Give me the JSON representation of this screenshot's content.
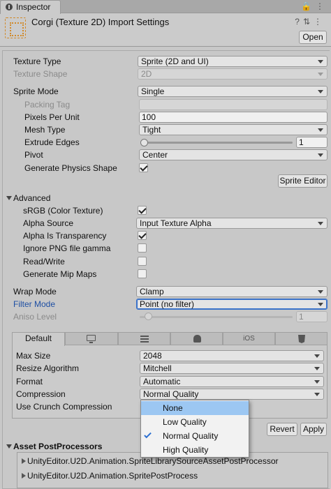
{
  "tab": {
    "title": "Inspector"
  },
  "header": {
    "title": "Corgi (Texture 2D) Import Settings",
    "open_label": "Open"
  },
  "fields": {
    "texture_type": {
      "label": "Texture Type",
      "value": "Sprite (2D and UI)"
    },
    "texture_shape": {
      "label": "Texture Shape",
      "value": "2D"
    },
    "sprite_mode": {
      "label": "Sprite Mode",
      "value": "Single"
    },
    "packing_tag": {
      "label": "Packing Tag",
      "value": ""
    },
    "pixels_per_unit": {
      "label": "Pixels Per Unit",
      "value": "100"
    },
    "mesh_type": {
      "label": "Mesh Type",
      "value": "Tight"
    },
    "extrude_edges": {
      "label": "Extrude Edges",
      "value": "1"
    },
    "pivot": {
      "label": "Pivot",
      "value": "Center"
    },
    "generate_physics_shape": {
      "label": "Generate Physics Shape",
      "checked": true
    },
    "sprite_editor_label": "Sprite Editor"
  },
  "advanced": {
    "label": "Advanced",
    "srgb": {
      "label": "sRGB (Color Texture)",
      "checked": true
    },
    "alpha_source": {
      "label": "Alpha Source",
      "value": "Input Texture Alpha"
    },
    "alpha_is_transparency": {
      "label": "Alpha Is Transparency",
      "checked": true
    },
    "ignore_png_gamma": {
      "label": "Ignore PNG file gamma",
      "checked": false
    },
    "read_write": {
      "label": "Read/Write",
      "checked": false
    },
    "generate_mip_maps": {
      "label": "Generate Mip Maps",
      "checked": false
    }
  },
  "wrap": {
    "wrap_mode": {
      "label": "Wrap Mode",
      "value": "Clamp"
    },
    "filter_mode": {
      "label": "Filter Mode",
      "value": "Point (no filter)"
    },
    "aniso_level": {
      "label": "Aniso Level",
      "value": "1"
    }
  },
  "platform": {
    "tabs": [
      {
        "label": "Default",
        "icon": "default"
      },
      {
        "label": "",
        "icon": "monitor-icon"
      },
      {
        "label": "",
        "icon": "grid-icon"
      },
      {
        "label": "",
        "icon": "android-icon"
      },
      {
        "label": "iOS",
        "icon": "ios"
      },
      {
        "label": "",
        "icon": "html5-icon"
      }
    ],
    "max_size": {
      "label": "Max Size",
      "value": "2048"
    },
    "resize_algorithm": {
      "label": "Resize Algorithm",
      "value": "Mitchell"
    },
    "format": {
      "label": "Format",
      "value": "Automatic"
    },
    "compression": {
      "label": "Compression",
      "value": "Normal Quality"
    },
    "use_crunch": {
      "label": "Use Crunch Compression"
    }
  },
  "compression_menu": {
    "options": [
      "None",
      "Low Quality",
      "Normal Quality",
      "High Quality"
    ],
    "selected": "Normal Quality",
    "highlighted": "None"
  },
  "actions": {
    "revert": "Revert",
    "apply": "Apply"
  },
  "postprocessors": {
    "label": "Asset PostProcessors",
    "items": [
      "UnityEditor.U2D.Animation.SpriteLibrarySourceAssetPostProcessor",
      "UnityEditor.U2D.Animation.SpritePostProcess"
    ]
  },
  "colors": {
    "accent": "#3a72c9",
    "highlight": "#9cc7f2",
    "label_blue": "#1e4fa3"
  }
}
